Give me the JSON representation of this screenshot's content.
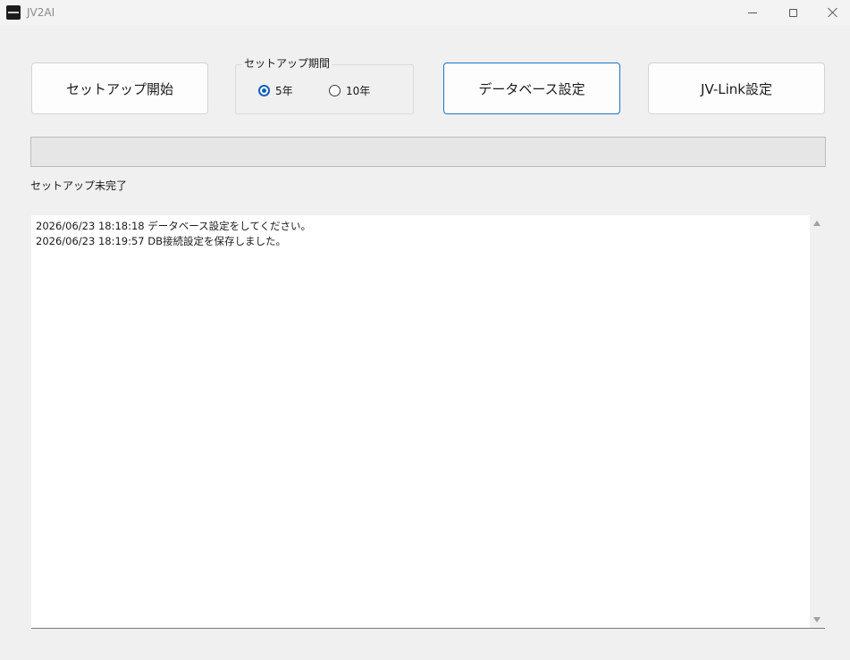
{
  "window": {
    "title": "JV2AI"
  },
  "toolbar": {
    "setup_start_label": "セットアップ開始",
    "database_settings_label": "データベース設定",
    "jvlink_settings_label": "JV-Link設定"
  },
  "setup_period": {
    "legend": "セットアップ期間",
    "options": [
      {
        "label": "5年",
        "selected": true
      },
      {
        "label": "10年",
        "selected": false
      }
    ]
  },
  "progress": {
    "value": 0
  },
  "status": {
    "text": "セットアップ未完了"
  },
  "log": {
    "lines": [
      "2026/06/23 18:18:18 データベース設定をしてください。",
      "2026/06/23 18:19:57 DB接続設定を保存しました。"
    ]
  },
  "colors": {
    "accent": "#1a73c7",
    "radio_selected": "#1260b8",
    "progress_fill": "#06b025"
  }
}
